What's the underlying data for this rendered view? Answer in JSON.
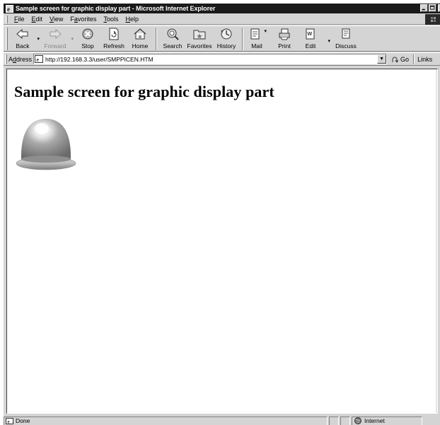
{
  "window": {
    "title": "Sample screen for graphic display part - Microsoft Internet Explorer"
  },
  "menu": {
    "items": [
      {
        "label": "File",
        "key": "F",
        "rest": "ile"
      },
      {
        "label": "Edit",
        "key": "E",
        "rest": "dit"
      },
      {
        "label": "View",
        "key": "V",
        "rest": "iew"
      },
      {
        "label": "Favorites",
        "key": "a",
        "pre": "F",
        "rest": "vorites"
      },
      {
        "label": "Tools",
        "key": "T",
        "rest": "ools"
      },
      {
        "label": "Help",
        "key": "H",
        "rest": "elp"
      }
    ]
  },
  "toolbar": {
    "back": "Back",
    "forward": "Forward",
    "stop": "Stop",
    "refresh": "Refresh",
    "home": "Home",
    "search": "Search",
    "favorites": "Favorites",
    "history": "History",
    "mail": "Mail",
    "print": "Print",
    "edit": "Edit",
    "discuss": "Discuss"
  },
  "address": {
    "label_pre": "A",
    "label_key": "d",
    "label_rest": "dress",
    "url": "http://192.168.3.3/user/SMPPICEN.HTM",
    "go": "Go",
    "links": "Links"
  },
  "page": {
    "heading": "Sample screen for graphic display part"
  },
  "status": {
    "text": "Done",
    "zone": "Internet"
  }
}
